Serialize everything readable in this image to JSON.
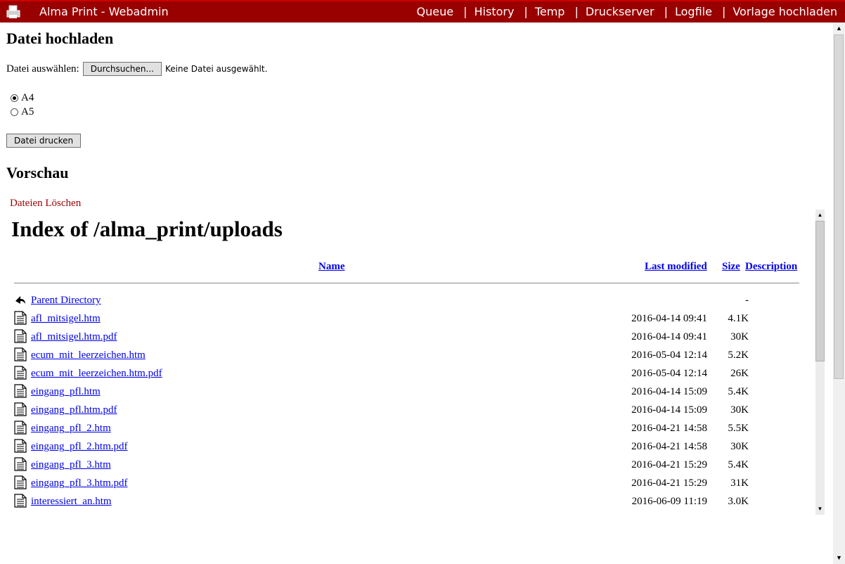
{
  "header": {
    "app_title": "Alma Print - Webadmin",
    "logo_icon": "printer-logo-icon",
    "nav": [
      "Queue",
      "History",
      "Temp",
      "Druckserver",
      "Logfile",
      "Vorlage hochladen"
    ]
  },
  "upload": {
    "heading": "Datei hochladen",
    "file_label": "Datei auswählen:",
    "browse_button": "Durchsuchen...",
    "no_file": "Keine Datei ausgewählt.",
    "formats": [
      {
        "label": "A4",
        "selected": true
      },
      {
        "label": "A5",
        "selected": false
      }
    ],
    "print_button": "Datei drucken"
  },
  "preview": {
    "heading": "Vorschau",
    "delete_link": "Dateien Löschen",
    "index_title": "Index of /alma_print/uploads",
    "columns": {
      "name": "Name",
      "last_modified": "Last modified",
      "size": "Size",
      "description": "Description"
    },
    "parent": {
      "name": "Parent Directory",
      "size": "-"
    },
    "files": [
      {
        "name": "afl_mitsigel.htm",
        "modified": "2016-04-14 09:41",
        "size": "4.1K"
      },
      {
        "name": "afl_mitsigel.htm.pdf",
        "modified": "2016-04-14 09:41",
        "size": "30K"
      },
      {
        "name": "ecum_mit_leerzeichen.htm",
        "modified": "2016-05-04 12:14",
        "size": "5.2K"
      },
      {
        "name": "ecum_mit_leerzeichen.htm.pdf",
        "modified": "2016-05-04 12:14",
        "size": "26K"
      },
      {
        "name": "eingang_pfl.htm",
        "modified": "2016-04-14 15:09",
        "size": "5.4K"
      },
      {
        "name": "eingang_pfl.htm.pdf",
        "modified": "2016-04-14 15:09",
        "size": "30K"
      },
      {
        "name": "eingang_pfl_2.htm",
        "modified": "2016-04-21 14:58",
        "size": "5.5K"
      },
      {
        "name": "eingang_pfl_2.htm.pdf",
        "modified": "2016-04-21 14:58",
        "size": "30K"
      },
      {
        "name": "eingang_pfl_3.htm",
        "modified": "2016-04-21 15:29",
        "size": "5.4K"
      },
      {
        "name": "eingang_pfl_3.htm.pdf",
        "modified": "2016-04-21 15:29",
        "size": "31K"
      },
      {
        "name": "interessiert_an.htm",
        "modified": "2016-06-09 11:19",
        "size": "3.0K"
      }
    ]
  }
}
